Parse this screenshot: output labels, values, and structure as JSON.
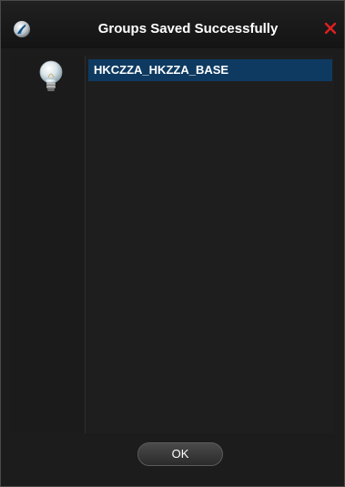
{
  "dialog": {
    "title": "Groups Saved Successfully",
    "close_icon": "close-icon",
    "app_icon": "app-logo-icon",
    "info_icon": "lightbulb-icon"
  },
  "groups": {
    "items": [
      {
        "label": "HKCZZA_HKZZA_BASE",
        "selected": true
      }
    ]
  },
  "buttons": {
    "ok_label": "OK"
  },
  "colors": {
    "background": "#1c1c1c",
    "selection": "#0e3a61",
    "close": "#e02020"
  }
}
